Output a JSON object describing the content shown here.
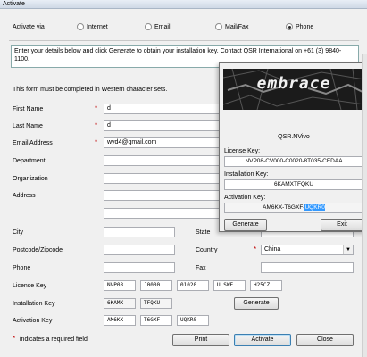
{
  "window": {
    "title": "Activate"
  },
  "activate_via": {
    "label": "Activate via",
    "options": [
      "Internet",
      "Email",
      "Mail/Fax",
      "Phone"
    ],
    "selected": "Phone"
  },
  "info_text": "Enter your details below and click Generate to obtain your installation key. Contact QSR International on +61 (3) 9840-1100.",
  "western_note": "This form must be completed in Western character sets.",
  "form": {
    "first_name": {
      "label": "First Name",
      "value": "d"
    },
    "last_name": {
      "label": "Last Name",
      "value": "d"
    },
    "email": {
      "label": "Email Address",
      "value": "wyd4@gmail.com"
    },
    "department": {
      "label": "Department"
    },
    "organization": {
      "label": "Organization"
    },
    "address": {
      "label": "Address"
    },
    "city": {
      "label": "City"
    },
    "state": {
      "label": "State"
    },
    "postcode": {
      "label": "Postcode/Zipcode"
    },
    "country": {
      "label": "Country",
      "value": "China"
    },
    "phone": {
      "label": "Phone"
    },
    "fax": {
      "label": "Fax"
    },
    "license_key": {
      "label": "License Key",
      "parts": [
        "NVP08",
        "J0000",
        "01020",
        "ULSWE",
        "H25CZ"
      ]
    },
    "installation_key": {
      "label": "Installation Key",
      "parts": [
        "6KAMX",
        "TFQKU"
      ]
    },
    "activation_key": {
      "label": "Activation Key",
      "parts": [
        "AM6KX",
        "T6GXF",
        "UQKR0"
      ]
    },
    "generate_label": "Generate",
    "required_note": "indicates a required field",
    "asterisk": "*"
  },
  "buttons": {
    "print": "Print",
    "activate": "Activate",
    "close": "Close"
  },
  "keygen": {
    "logo_text": "embrace",
    "product": "QSR.NVivo",
    "license_label": "License Key:",
    "license_value": "NVP08-CV000-C0020-8T035-CEDAA",
    "install_label": "Installation Key:",
    "install_value": "6KAMXTFQKU",
    "activation_label": "Activation Key:",
    "activation_value_plain": "AM6KX-T6GXF-",
    "activation_value_selected": "UQKR0",
    "generate": "Generate",
    "exit": "Exit"
  }
}
